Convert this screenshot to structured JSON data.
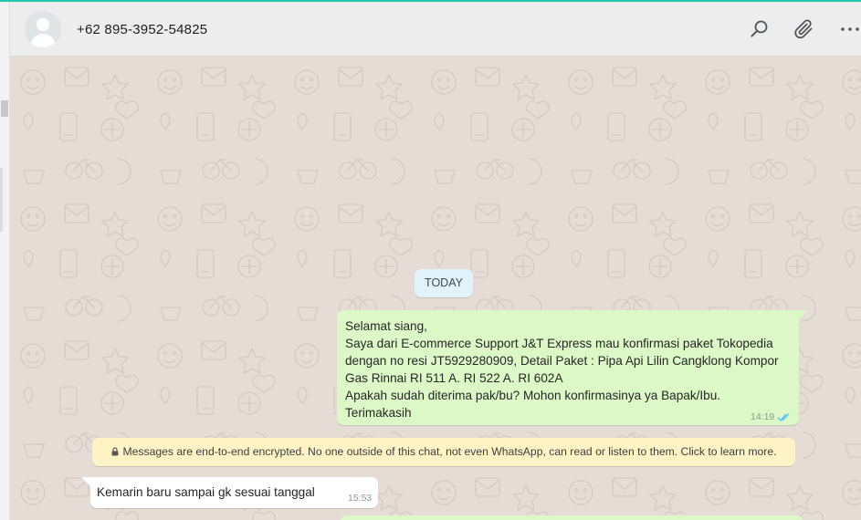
{
  "header": {
    "contact_name": "+62 895-3952-54825",
    "icons": [
      "search-icon",
      "attach-icon",
      "menu-icon"
    ]
  },
  "chat": {
    "date_divider": "TODAY",
    "outgoing_message": {
      "text": "Selamat siang,\nSaya dari E-commerce Support J&T Express mau konfirmasi paket Tokopedia\ndengan no resi JT5929280909, Detail Paket : Pipa Api Lilin Cangklong Kompor\nGas Rinnai RI 511 A. RI 522 A. RI 602A\nApakah sudah diterima pak/bu? Mohon konfirmasinya ya Bapak/Ibu.\nTerimakasih",
      "time": "14:19",
      "status": "read"
    },
    "encryption_notice": "Messages are end-to-end encrypted. No one outside of this chat, not even WhatsApp, can read or listen to them. Click to learn more.",
    "incoming_message": {
      "text": "Kemarin baru sampai gk sesuai tanggal",
      "time": "15:53"
    }
  },
  "colors": {
    "accent": "#20c5b0",
    "chat_background": "#e5ddd5",
    "outgoing_bubble": "#dcf8c6",
    "incoming_bubble": "#ffffff",
    "date_pill": "#e1f2fb",
    "encryption_bubble": "#fdf3c4",
    "read_ticks": "#4fc3f7"
  }
}
